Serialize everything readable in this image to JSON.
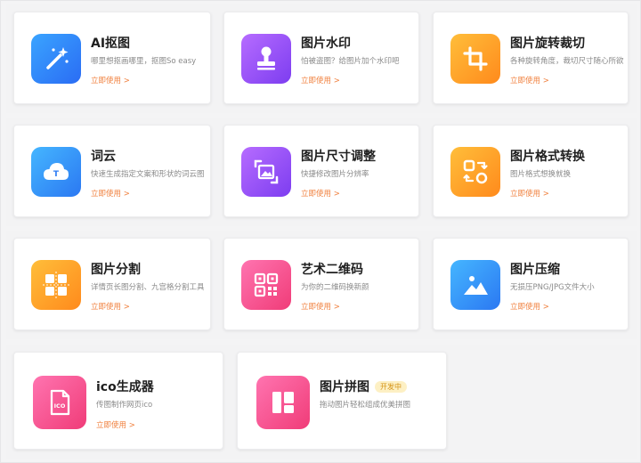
{
  "cards": [
    {
      "title": "AI抠图",
      "desc": "哪里想抠画哪里，抠图So easy",
      "link": "立即使用 >",
      "icon": "magic-wand-icon"
    },
    {
      "title": "图片水印",
      "desc": "怕被盗图？给图片加个水印吧",
      "link": "立即使用 >",
      "icon": "stamp-icon"
    },
    {
      "title": "图片旋转裁切",
      "desc": "各种旋转角度，裁切尺寸随心所欲",
      "link": "立即使用 >",
      "icon": "crop-icon"
    },
    {
      "title": "词云",
      "desc": "快速生成指定文案和形状的词云图",
      "link": "立即使用 >",
      "icon": "cloud-icon",
      "icon_text": "T"
    },
    {
      "title": "图片尺寸调整",
      "desc": "快捷修改图片分辨率",
      "link": "立即使用 >",
      "icon": "resize-icon"
    },
    {
      "title": "图片格式转换",
      "desc": "图片格式想换就换",
      "link": "立即使用 >",
      "icon": "convert-icon"
    },
    {
      "title": "图片分割",
      "desc": "详情页长图分割、九宫格分割工具",
      "link": "立即使用 >",
      "icon": "grid-split-icon"
    },
    {
      "title": "艺术二维码",
      "desc": "为你的二维码换新颜",
      "link": "立即使用 >",
      "icon": "qr-code-icon"
    },
    {
      "title": "图片压缩",
      "desc": "无损压PNG/JPG文件大小",
      "link": "立即使用 >",
      "icon": "mountain-image-icon"
    },
    {
      "title": "ico生成器",
      "desc": "传图制作网页ico",
      "link": "立即使用 >",
      "icon": "ico-file-icon",
      "icon_text": "ICO"
    },
    {
      "title": "图片拼图",
      "desc": "拖动图片轻松组成优美拼图",
      "link": "",
      "icon": "collage-icon",
      "badge": "开发中"
    }
  ]
}
